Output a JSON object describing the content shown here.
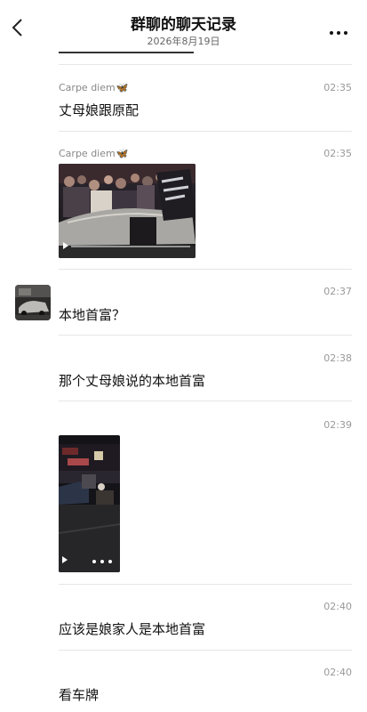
{
  "header": {
    "title": "群聊的聊天记录",
    "date": "2026年8月19日"
  },
  "messages": [
    {
      "sender": "Carpe diem",
      "sender_icon": "butterfly-emoji",
      "time": "02:35",
      "text": "丈母娘跟原配"
    },
    {
      "sender": "Carpe diem",
      "sender_icon": "butterfly-emoji",
      "time": "02:35",
      "type": "video",
      "description": "crowd around car at night"
    },
    {
      "time": "02:37",
      "text": "本地首富？",
      "avatar": "car-photo-avatar"
    },
    {
      "time": "02:38",
      "text": "那个丈母娘说的本地首富"
    },
    {
      "time": "02:39",
      "type": "video",
      "description": "night street with cars"
    },
    {
      "time": "02:40",
      "text": "应该是娘家人是本地首富"
    },
    {
      "time": "02:40",
      "text": "看车牌"
    }
  ],
  "colors": {
    "background": "#ffffff",
    "text": "#111111",
    "meta": "#999999",
    "divider": "#e6e6e6",
    "butterfly": "#2a8fd8"
  }
}
